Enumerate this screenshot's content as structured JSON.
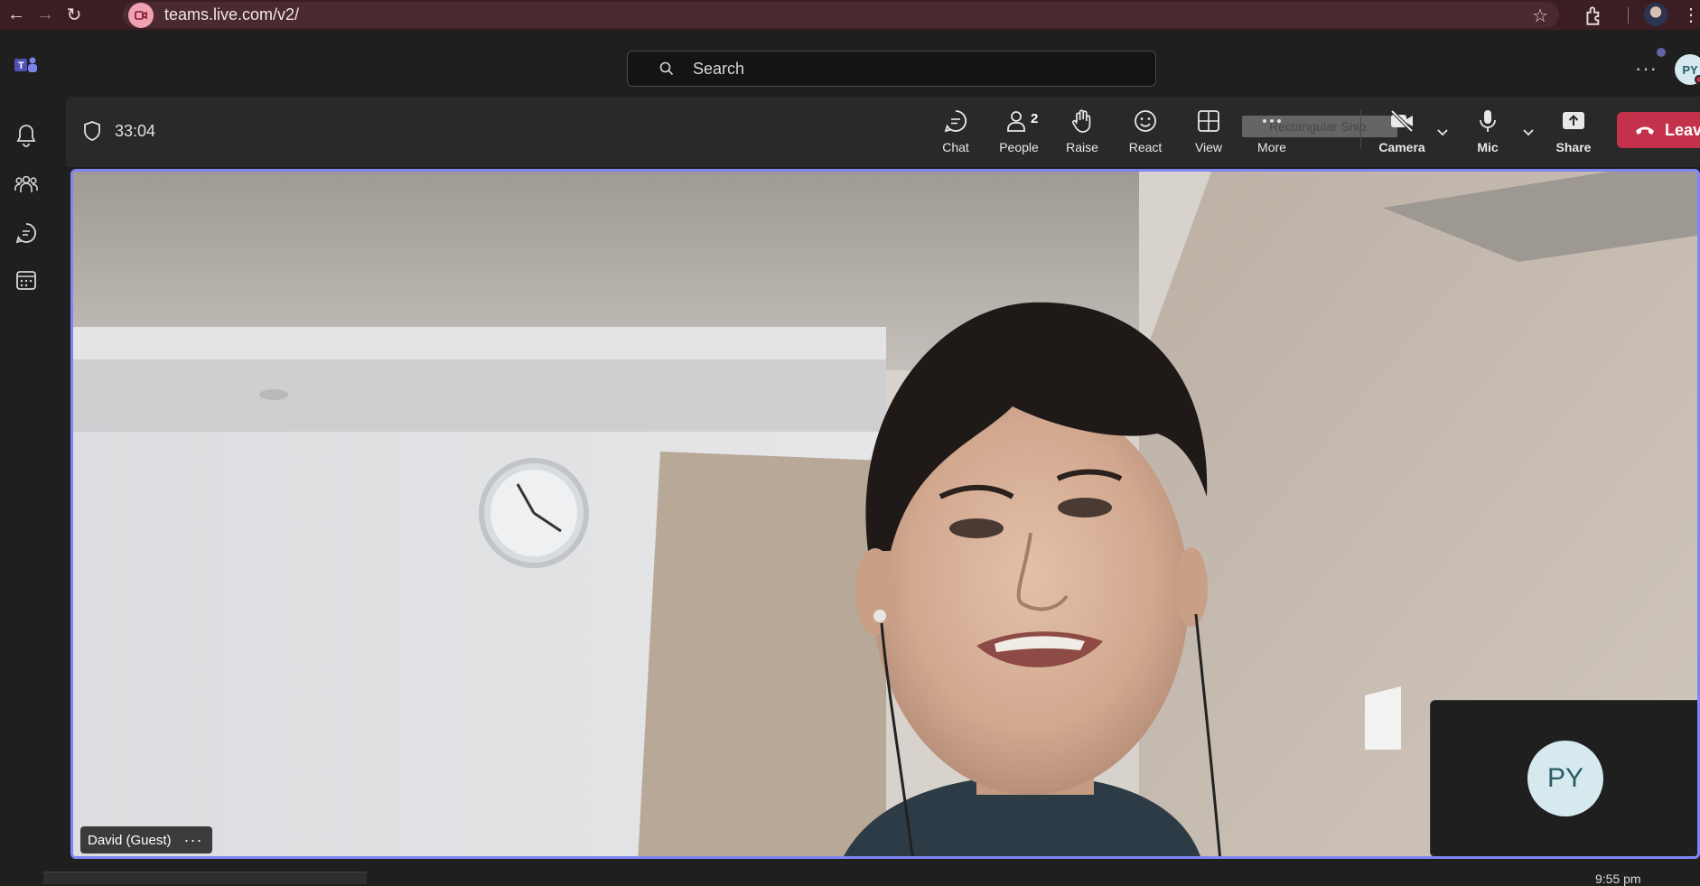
{
  "browser": {
    "url": "teams.live.com/v2/"
  },
  "header": {
    "search_placeholder": "Search",
    "more": "···",
    "avatar_initials": "PY"
  },
  "toolbar": {
    "timer": "33:04",
    "chat": "Chat",
    "people": "People",
    "people_count": "2",
    "raise": "Raise",
    "react": "React",
    "view": "View",
    "more": "More",
    "camera": "Camera",
    "mic": "Mic",
    "share": "Share",
    "leave": "Leave",
    "snip_text": "Rectangular Snip"
  },
  "stage": {
    "participant_name": "David (Guest)",
    "participant_menu": "···",
    "self_initials": "PY"
  },
  "taskbar": {
    "clock": "9:55 pm"
  },
  "colors": {
    "accent": "#7f85f5",
    "leave": "#c4314b",
    "browser_bar": "#3b1e24"
  }
}
